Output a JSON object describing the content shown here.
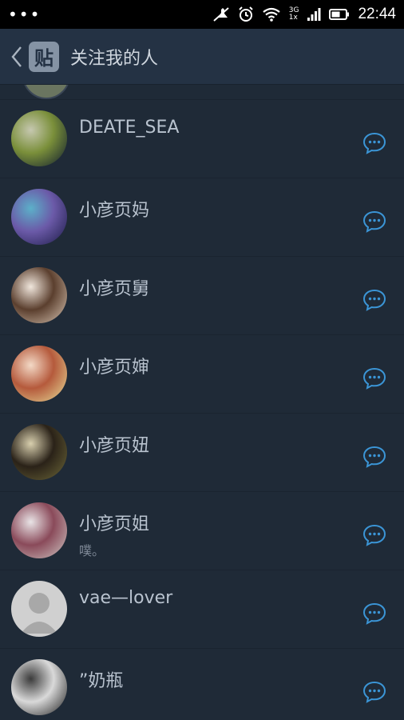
{
  "status": {
    "dots": "•••",
    "time": "22:44",
    "network_top": "3G",
    "network_bottom": "1x"
  },
  "header": {
    "back_icon": "chevron-left-icon",
    "app_badge": "贴",
    "title": "关注我的人"
  },
  "followers": [
    {
      "name": "DEATE_SEA",
      "subtitle": "",
      "avatar_colors": [
        "#0d1a2e",
        "#7a8f3a",
        "#c6c8b0"
      ]
    },
    {
      "name": "小彦页妈",
      "subtitle": "",
      "avatar_colors": [
        "#1b1a46",
        "#6b5aa8",
        "#5cb0c9"
      ]
    },
    {
      "name": "小彦页舅",
      "subtitle": "",
      "avatar_colors": [
        "#d9c6b4",
        "#5b3f2e",
        "#f0e6dc"
      ]
    },
    {
      "name": "小彦页婶",
      "subtitle": "",
      "avatar_colors": [
        "#e8e09a",
        "#b55a3c",
        "#f3d9c6"
      ]
    },
    {
      "name": "小彦页妞",
      "subtitle": "",
      "avatar_colors": [
        "#6f6a3a",
        "#2a2218",
        "#d8cfae"
      ]
    },
    {
      "name": "小彦页姐",
      "subtitle": "噗。",
      "avatar_colors": [
        "#cfc8c4",
        "#8a4a5a",
        "#e9e4e6"
      ]
    },
    {
      "name": "vae—lover",
      "subtitle": "",
      "avatar_colors": [
        "#cfcfcf",
        "#a9a9a9",
        "#e2e2e2"
      ]
    },
    {
      "name": "”奶瓶",
      "subtitle": "",
      "avatar_colors": [
        "#1c1c1c",
        "#d9d9d9",
        "#3b3b3b"
      ]
    }
  ],
  "colors": {
    "accent": "#3b95d6",
    "background": "#1f2a37",
    "header": "#243244"
  }
}
